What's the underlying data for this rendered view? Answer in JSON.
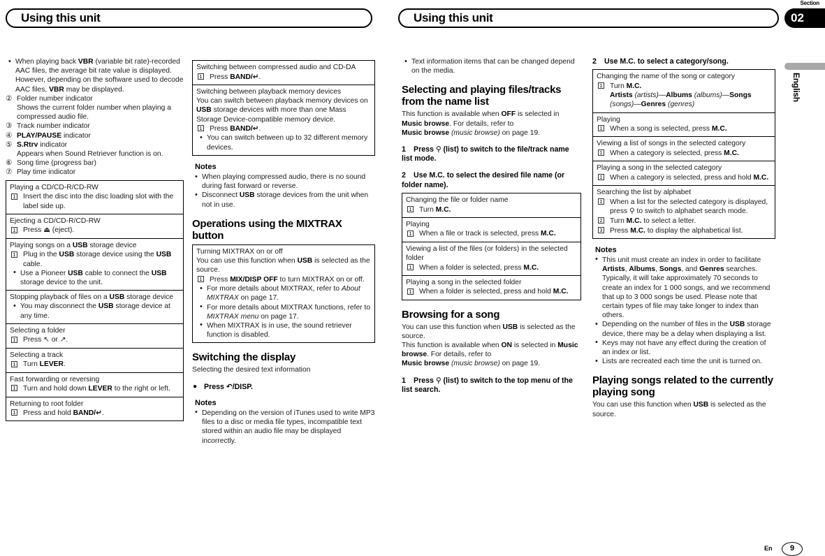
{
  "header": {
    "left_title": "Using this unit",
    "right_title": "Using this unit",
    "section_label": "Section",
    "section_number": "02",
    "language_tab": "English"
  },
  "footer": {
    "language_code": "En",
    "page_number": "9"
  },
  "col1": {
    "vbr_note": "When playing back VBR (variable bit rate)-recorded AAC files, the average bit rate value is displayed. However, depending on the software used to decode AAC files, VBR may be displayed.",
    "vbr_bold": "VBR",
    "indicators": [
      {
        "num": "②",
        "label": "Folder number indicator",
        "desc": "Shows the current folder number when playing a compressed audio file."
      },
      {
        "num": "③",
        "label": "Track number indicator",
        "desc": ""
      },
      {
        "num": "④",
        "label_bold": "PLAY/PAUSE",
        "label_rest": " indicator",
        "desc": ""
      },
      {
        "num": "⑤",
        "label_bold": "S.Rtrv",
        "label_rest": " indicator",
        "desc": "Appears when Sound Retriever function is on."
      },
      {
        "num": "⑥",
        "label": "Song time (progress bar)",
        "desc": ""
      },
      {
        "num": "⑦",
        "label": "Play time indicator",
        "desc": ""
      }
    ],
    "table": [
      {
        "title": "Playing a CD/CD-R/CD-RW",
        "steps": [
          {
            "n": "1",
            "text": "Insert the disc into the disc loading slot with the label side up."
          }
        ],
        "bullets": [],
        "thick": false
      },
      {
        "title": "Ejecting a CD/CD-R/CD-RW",
        "steps": [
          {
            "n": "1",
            "text": "Press ⏏ (eject)."
          }
        ],
        "bullets": [],
        "thick": true
      },
      {
        "title": "Playing songs on a USB storage device",
        "steps": [
          {
            "n": "1",
            "text": "Plug in the USB storage device using the USB cable."
          }
        ],
        "bullets": [
          "Use a Pioneer USB cable to connect the USB storage device to the unit."
        ],
        "thick": true
      },
      {
        "title": "Stopping playback of files on a USB storage device",
        "steps": [],
        "bullets": [
          "You may disconnect the USB storage device at any time."
        ],
        "thick": true
      },
      {
        "title": "Selecting a folder",
        "steps": [
          {
            "n": "1",
            "text": "Press ↖ or ↗."
          }
        ],
        "bullets": [],
        "thick": false
      },
      {
        "title": "Selecting a track",
        "steps": [
          {
            "n": "1",
            "text": "Turn LEVER."
          }
        ],
        "bullets": [],
        "thick": false
      },
      {
        "title": "Fast forwarding or reversing",
        "steps": [
          {
            "n": "1",
            "text": "Turn and hold down LEVER to the right or left."
          }
        ],
        "bullets": [],
        "thick": false
      },
      {
        "title": "Returning to root folder",
        "steps": [
          {
            "n": "1",
            "text": "Press and hold BAND/↵."
          }
        ],
        "bullets": [],
        "thick": false
      }
    ]
  },
  "col2": {
    "table": [
      {
        "title": "Switching between compressed audio and CD-DA",
        "steps": [
          {
            "n": "1",
            "text": "Press BAND/↵."
          }
        ],
        "bullets": []
      },
      {
        "title": "Switching between playback memory devices",
        "intro": "You can switch between playback memory devices on USB storage devices with more than one Mass Storage Device-compatible memory device.",
        "steps": [
          {
            "n": "1",
            "text": "Press BAND/↵."
          }
        ],
        "bullets": [
          "You can switch between up to 32 different memory devices."
        ]
      }
    ],
    "notes_heading": "Notes",
    "notes": [
      "When playing compressed audio, there is no sound during fast forward or reverse.",
      "Disconnect USB storage devices from the unit when not in use."
    ],
    "mixtrax_heading": "Operations using the MIXTRAX button",
    "mixtrax_box": {
      "title": "Turning MIXTRAX on or off",
      "intro": "You can use this function when USB is selected as the source.",
      "intro_bold": "USB",
      "steps": [
        {
          "n": "1",
          "text": "Press MIX/DISP OFF to turn MIXTRAX on or off."
        }
      ],
      "bullets": [
        "For more details about MIXTRAX, refer to About MIXTRAX on page 17.",
        "For more details about MIXTRAX functions, refer to MIXTRAX menu on page 17.",
        "When MIXTRAX is in use, the sound retriever function is disabled."
      ]
    },
    "display_heading": "Switching the display",
    "display_sub": "Selecting the desired text information",
    "display_step": "Press ↶/DISP.",
    "display_notes_heading": "Notes",
    "display_notes": [
      "Depending on the version of iTunes used to write MP3 files to a disc or media file types, incompatible text stored within an audio file may be displayed incorrectly."
    ]
  },
  "col3": {
    "top_bullet": "Text information items that can be changed depend on the media.",
    "heading": "Selecting and playing files/tracks from the name list",
    "intro_line1": "This function is available when OFF is selected in Music browse. For details, refer to",
    "intro_line2": "Music browse (music browse) on page 19.",
    "step1_num": "1",
    "step1_text": "Press ⚲ (list) to switch to the file/track name list mode.",
    "step2_num": "2",
    "step2_text": "Use M.C. to select the desired file name (or folder name).",
    "table": [
      {
        "title": "Changing the file or folder name",
        "steps": [
          {
            "n": "1",
            "text": "Turn M.C."
          }
        ],
        "thick": false
      },
      {
        "title": "Playing",
        "steps": [
          {
            "n": "1",
            "text": "When a file or track is selected, press M.C."
          }
        ],
        "thick": false
      },
      {
        "title": "Viewing a list of the files (or folders) in the selected folder",
        "steps": [
          {
            "n": "1",
            "text": "When a folder is selected, press M.C."
          }
        ],
        "thick": false
      },
      {
        "title": "Playing a song in the selected folder",
        "steps": [
          {
            "n": "1",
            "text": "When a folder is selected, press and hold M.C."
          }
        ],
        "thick": true
      }
    ],
    "browse_heading": "Browsing for a song",
    "browse_line1": "You can use this function when USB is selected as the source.",
    "browse_line2": "This function is available when ON is selected in Music browse. For details, refer to",
    "browse_line3": "Music browse (music browse) on page 19.",
    "browse_step_num": "1",
    "browse_step_text": "Press ⚲ (list) to switch to the top menu of the list search."
  },
  "col4": {
    "step2_num": "2",
    "step2_text": "Use M.C. to select a category/song.",
    "table": [
      {
        "title": "Changing the name of the song or category",
        "steps": [
          {
            "n": "1",
            "text": "Turn M.C."
          }
        ],
        "extra": "Artists (artists)—Albums (albums)—Songs (songs)—Genres (genres)",
        "thick": true
      },
      {
        "title": "Playing",
        "steps": [
          {
            "n": "1",
            "text": "When a song is selected, press M.C."
          }
        ],
        "thick": false
      },
      {
        "title": "Viewing a list of songs in the selected category",
        "steps": [
          {
            "n": "1",
            "text": "When a category is selected, press M.C."
          }
        ],
        "thick": true
      },
      {
        "title": "Playing a song in the selected category",
        "steps": [
          {
            "n": "1",
            "text": "When a category is selected, press and hold M.C."
          }
        ],
        "thick": true
      },
      {
        "title": "Searching the list by alphabet",
        "steps": [
          {
            "n": "1",
            "text": "When a list for the selected category is displayed, press ⚲ to switch to alphabet search mode."
          },
          {
            "n": "2",
            "text": "Turn M.C. to select a letter."
          },
          {
            "n": "3",
            "text": "Press M.C. to display the alphabetical list."
          }
        ],
        "thick": false
      }
    ],
    "notes_heading": "Notes",
    "notes": [
      "This unit must create an index in order to facilitate Artists, Albums, Songs, and Genres searches. Typically, it will take approximately 70 seconds to create an index for 1 000 songs, and we recommend that up to 3 000 songs be used. Please note that certain types of file may take longer to index than others.",
      "Depending on the number of files in the USB storage device, there may be a delay when displaying a list.",
      "Keys may not have any effect during the creation of an index or list.",
      "Lists are recreated each time the unit is turned on."
    ],
    "related_heading": "Playing songs related to the currently playing song",
    "related_text": "You can use this function when USB is selected as the source."
  }
}
